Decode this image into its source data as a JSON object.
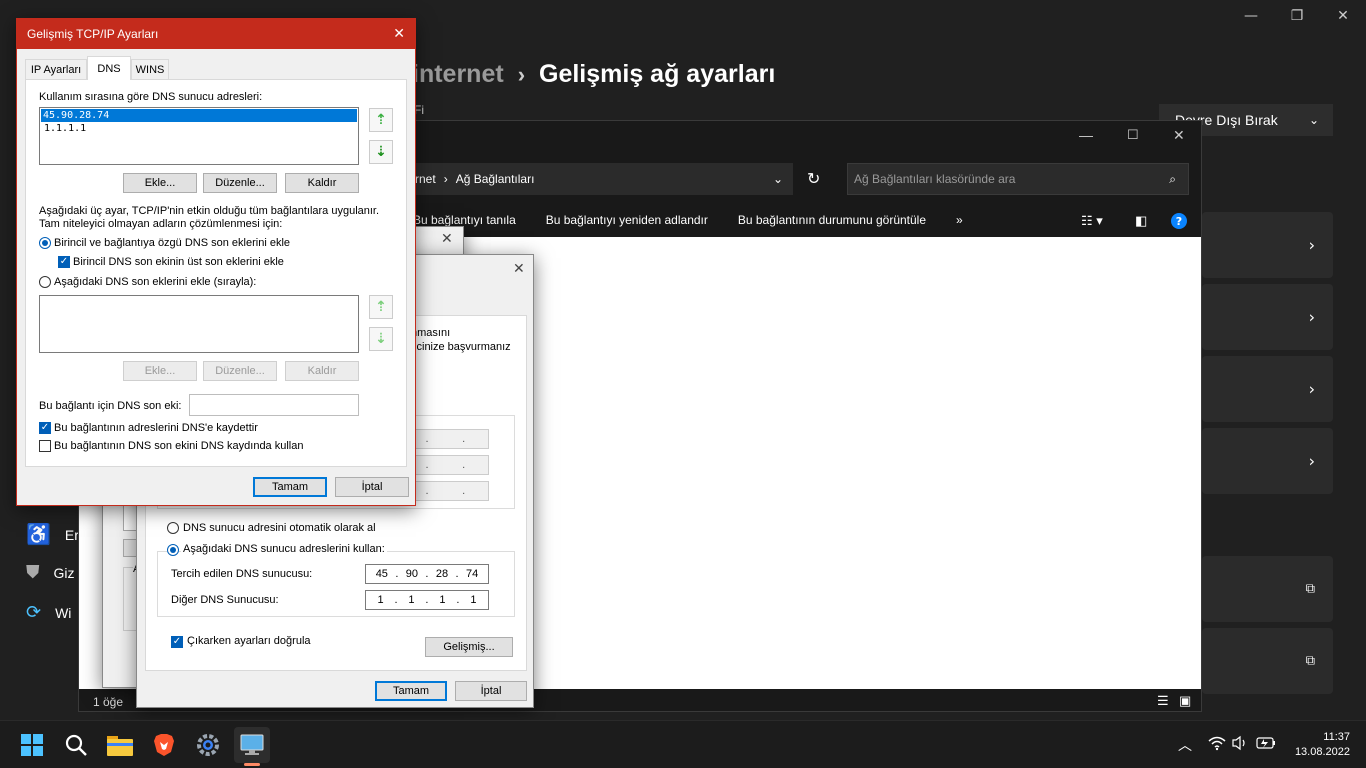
{
  "settings": {
    "breadcrumb_parent": "internet",
    "breadcrumb_sep": "›",
    "title": "Gelişmiş ağ ayarları",
    "subtitle_partial": "Fi",
    "disable_button": "Devre Dışı Bırak",
    "nav": [
      {
        "label": "Eriş",
        "icon": "accessibility-icon"
      },
      {
        "label": "Giz",
        "icon": "shield-icon"
      },
      {
        "label": "Wi",
        "icon": "windows-update-icon"
      }
    ]
  },
  "explorer": {
    "breadcrumb_parent": "rnet",
    "breadcrumb_current": "Ağ Bağlantıları",
    "search_placeholder": "Ağ Bağlantıları klasöründe ara",
    "commands": [
      "Bu bağlantıyı tanıla",
      "Bu bağlantıyı yeniden adlandır",
      "Bu bağlantının durumunu görüntüle"
    ],
    "more": "»",
    "status": "1 öğe"
  },
  "ipv4": {
    "text_line1": "nmasını",
    "text_line2": "ticinize başvurmanız",
    "radio_auto": "DNS sunucu adresini otomatik olarak al",
    "radio_manual": "Aşağıdaki DNS sunucu adreslerini kullan:",
    "preferred_label": "Tercih edilen DNS sunucusu:",
    "preferred": [
      "45",
      "90",
      "28",
      "74"
    ],
    "alternate_label": "Diğer DNS Sunucusu:",
    "alternate": [
      "1",
      "1",
      "1",
      "1"
    ],
    "validate_label": "Çıkarken ayarları doğrula",
    "advanced_button": "Gelişmiş...",
    "ok": "Tamam",
    "cancel": "İptal",
    "partial_label": "A"
  },
  "advanced": {
    "title": "Gelişmiş TCP/IP Ayarları",
    "tabs": [
      "IP Ayarları",
      "DNS",
      "WINS"
    ],
    "dns_list_label": "Kullanım sırasına göre DNS sunucu adresleri:",
    "dns_servers": [
      "45.90.28.74",
      "1.1.1.1"
    ],
    "add": "Ekle...",
    "edit": "Düzenle...",
    "remove": "Kaldır",
    "info_line1": "Aşağıdaki üç ayar, TCP/IP'nin etkin olduğu tüm bağlantılara uygulanır.",
    "info_line2": "Tam niteleyici olmayan adların çözümlenmesi için:",
    "radio_primary": "Birincil ve bağlantıya özgü DNS son eklerini ekle",
    "check_parent": "Birincil DNS son ekinin üst son eklerini ekle",
    "radio_list": "Aşağıdaki DNS son eklerini ekle (sırayla):",
    "suffix_label": "Bu bağlantı için DNS son eki:",
    "register_label": "Bu bağlantının adreslerini DNS'e kaydettir",
    "use_suffix_label": "Bu bağlantının DNS son ekini DNS kaydında kullan",
    "ok": "Tamam",
    "cancel": "İptal"
  },
  "taskbar": {
    "time": "11:37",
    "date": "13.08.2022"
  },
  "colors": {
    "accent": "#005fb8",
    "dialog_border": "#c42b1c"
  }
}
